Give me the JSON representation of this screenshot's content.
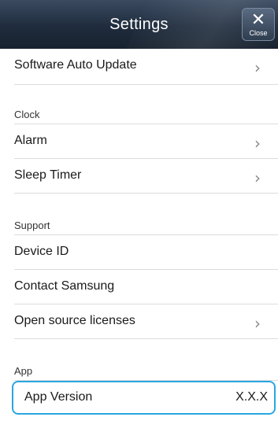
{
  "header": {
    "title": "Settings",
    "close_label": "Close",
    "close_glyph": "✕",
    "close_icon": "close-icon"
  },
  "rows": {
    "software_auto_update": {
      "label": "Software Auto Update",
      "chevron": "›"
    },
    "alarm": {
      "label": "Alarm",
      "chevron": "›"
    },
    "sleep_timer": {
      "label": "Sleep Timer",
      "chevron": "›"
    },
    "device_id": {
      "label": "Device ID"
    },
    "contact_samsung": {
      "label": "Contact Samsung"
    },
    "open_source_licenses": {
      "label": "Open source licenses",
      "chevron": "›"
    },
    "app_version": {
      "label": "App Version",
      "value": "X.X.X"
    }
  },
  "sections": {
    "clock": "Clock",
    "support": "Support",
    "app": "App"
  },
  "colors": {
    "header_bg": "#1f2c3d",
    "highlight_border": "#29a7e1",
    "divider": "#dcdcdc"
  }
}
